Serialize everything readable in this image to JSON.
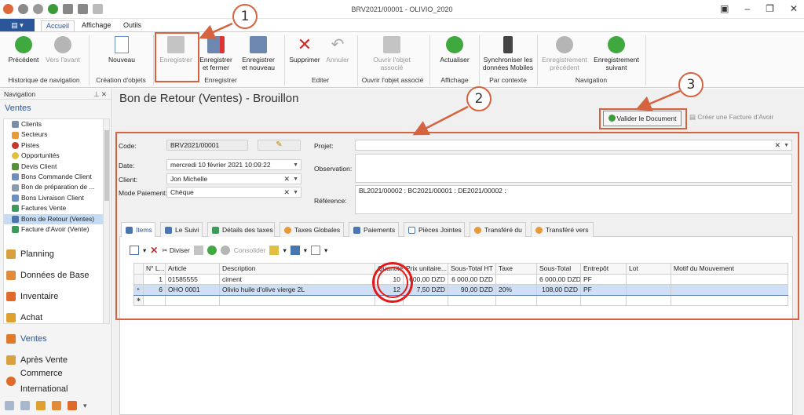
{
  "window": {
    "title": "BRV2021/00001 - OLIVIO_2020"
  },
  "ribbon_tabs": [
    {
      "label": "Accueil"
    },
    {
      "label": "Affichage"
    },
    {
      "label": "Outils"
    }
  ],
  "ribbon": {
    "precedent": "Précédent",
    "vers_avant": "Vers l'avant",
    "nouveau": "Nouveau",
    "enregistrer": "Enregistrer",
    "enregistrer_fermer_1": "Enregistrer",
    "enregistrer_fermer_2": "et fermer",
    "enregistrer_nouveau_1": "Enregistrer",
    "enregistrer_nouveau_2": "et nouveau",
    "supprimer": "Supprimer",
    "annuler": "Annuler",
    "ouvrir_objet_1": "Ouvrir l'objet",
    "ouvrir_objet_2": "associé",
    "actualiser": "Actualiser",
    "synchroniser_1": "Synchroniser les",
    "synchroniser_2": "données Mobiles",
    "enr_precedent_1": "Enregistrement",
    "enr_precedent_2": "précédent",
    "enr_suivant_1": "Enregistrement",
    "enr_suivant_2": "suivant",
    "groups": {
      "historique": "Historique de navigation",
      "creation": "Création d'objets",
      "enregistrer": "Enregistrer",
      "editer": "Editer",
      "ouvrir": "Ouvrir l'objet associé",
      "affichage": "Affichage",
      "contexte": "Par contexte",
      "navigation": "Navigation"
    }
  },
  "navigation": {
    "header": "Navigation",
    "pins": "⊥ ✕",
    "title": "Ventes",
    "items": [
      {
        "label": "Clients"
      },
      {
        "label": "Secteurs"
      },
      {
        "label": "Pistes"
      },
      {
        "label": "Opportunités"
      },
      {
        "label": "Devis Client"
      },
      {
        "label": "Bons Commande Client"
      },
      {
        "label": "Bon de préparation de ..."
      },
      {
        "label": "Bons Livraison Client"
      },
      {
        "label": "Factures Vente"
      },
      {
        "label": "Bons de Retour (Ventes)"
      },
      {
        "label": "Facture d'Avoir (Vente)"
      }
    ],
    "groups": [
      {
        "label": "Planning"
      },
      {
        "label": "Données de Base"
      },
      {
        "label": "Inventaire"
      },
      {
        "label": "Achat"
      },
      {
        "label": "Ventes"
      },
      {
        "label": "Après Vente"
      },
      {
        "label": "Commerce International"
      }
    ]
  },
  "page": {
    "title": "Bon de Retour (Ventes) - Brouillon",
    "validate_btn": "Valider le Document",
    "creer_facture": "Créer une Facture d'Avoir"
  },
  "form": {
    "code_label": "Code:",
    "code_value": "BRV2021/00001",
    "date_label": "Date:",
    "date_value": "mercredi 10 février 2021 10:09:22",
    "client_label": "Client:",
    "client_value": "Jon Michelle",
    "mode_label": "Mode Paiement:",
    "mode_value": "Chèque",
    "projet_label": "Projet:",
    "projet_value": "",
    "observation_label": "Observation:",
    "observation_value": "",
    "reference_label": "Référence:",
    "reference_value": "BL2021/00002 : BC2021/00001 : DE2021/00002 :"
  },
  "tabs": [
    {
      "label": "Items"
    },
    {
      "label": "Le Suivi"
    },
    {
      "label": "Détails des taxes"
    },
    {
      "label": "Taxes  Globales"
    },
    {
      "label": "Paiements"
    },
    {
      "label": "Pièces Jointes"
    },
    {
      "label": "Transféré du"
    },
    {
      "label": "Transféré vers"
    }
  ],
  "grid_toolbar": {
    "diviser": "Diviser",
    "consolider": "Consolider"
  },
  "grid": {
    "columns": [
      "N° L...",
      "Article",
      "Description",
      "Quantité",
      "Prix unitaire...",
      "Sous-Total HT",
      "Taxe",
      "Sous-Total",
      "Entrepôt",
      "Lot",
      "Motif du Mouvement"
    ],
    "rows": [
      {
        "n": "1",
        "article": "01585555",
        "description": "ciment",
        "quantite": "10",
        "prix": "600,00 DZD",
        "sous_total_ht": "6 000,00 DZD",
        "taxe": "",
        "sous_total": "6 000,00 DZD",
        "entrepot": "PF",
        "lot": "",
        "motif": ""
      },
      {
        "n": "6",
        "article": "OHO 0001",
        "description": "Olivio huile d'olive vierge 2L",
        "quantite": "12",
        "prix": "7,50 DZD",
        "sous_total_ht": "90,00 DZD",
        "taxe": "20%",
        "sous_total": "108,00 DZD",
        "entrepot": "PF",
        "lot": "",
        "motif": ""
      }
    ]
  },
  "annotations": [
    "1",
    "2",
    "3"
  ],
  "colors": {
    "accent": "#2b579a",
    "annotation": "#d6633f",
    "ring": "#e21a1a",
    "selection": "#cfe0f6"
  }
}
